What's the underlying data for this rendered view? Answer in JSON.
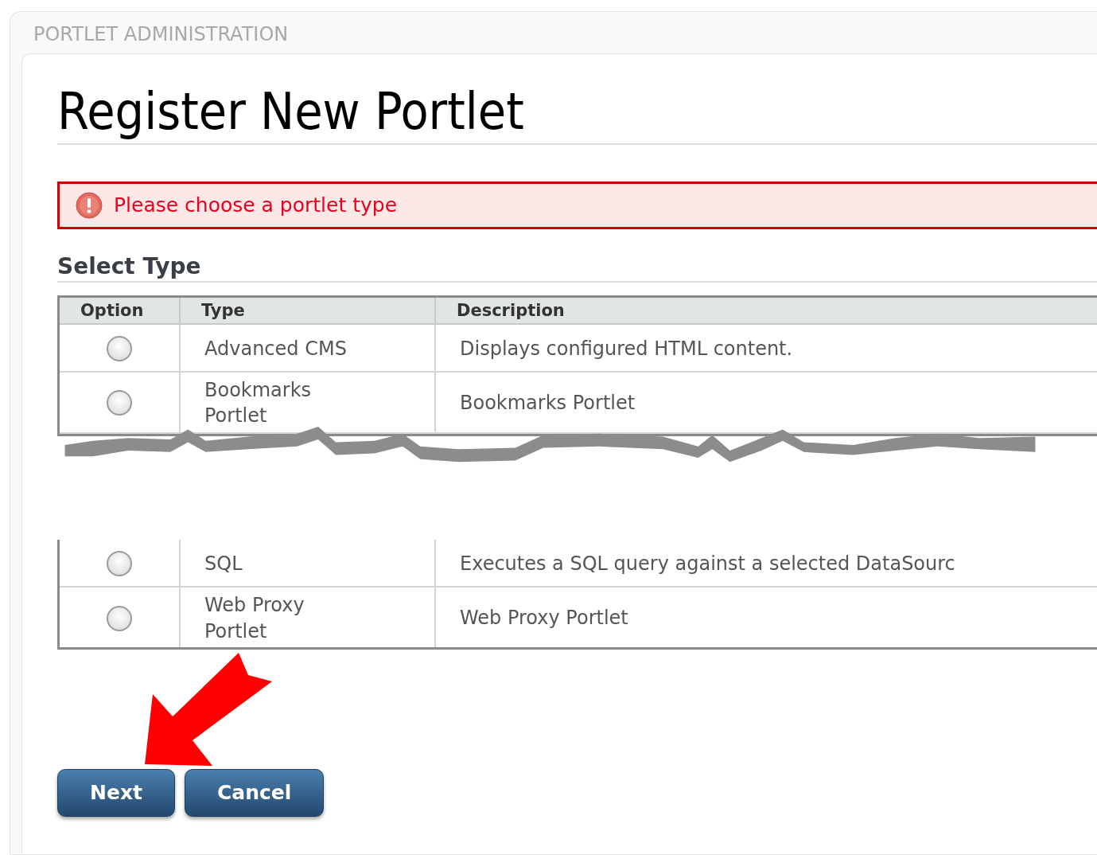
{
  "panel": {
    "title": "PORTLET ADMINISTRATION"
  },
  "page_title": "Register New Portlet",
  "error": {
    "message": "Please choose a portlet type"
  },
  "section": {
    "title": "Select Type"
  },
  "table": {
    "columns": [
      "Option",
      "Type",
      "Description"
    ],
    "rows_top": [
      {
        "type": "Advanced CMS",
        "description": "Displays configured HTML content.",
        "selected": false
      },
      {
        "type": "Bookmarks Portlet",
        "description": "Bookmarks Portlet",
        "selected": false
      }
    ],
    "rows_bottom": [
      {
        "type": "SQL",
        "description": "Executes a SQL query against a selected DataSourc",
        "selected": false
      },
      {
        "type": "Web Proxy Portlet",
        "description": "Web Proxy Portlet",
        "selected": false
      }
    ]
  },
  "buttons": [
    "Next",
    "Cancel"
  ]
}
